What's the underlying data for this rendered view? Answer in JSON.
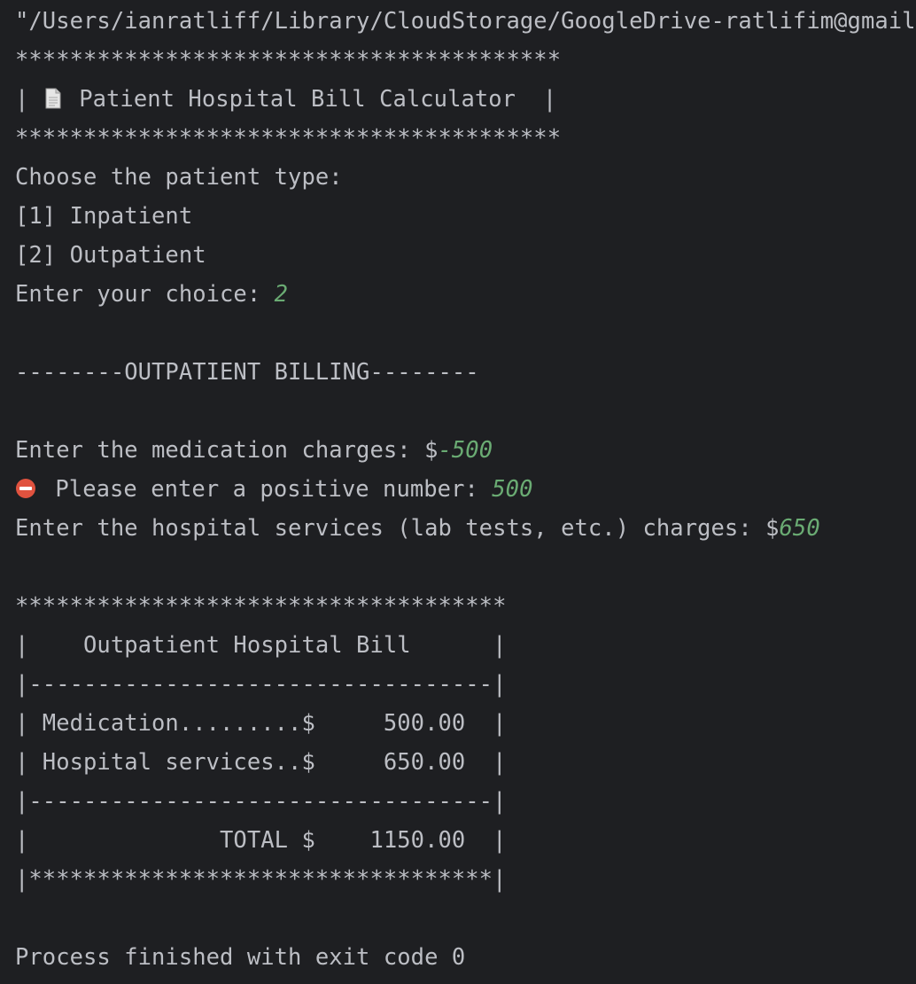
{
  "console": {
    "command_path": "\"/Users/ianratliff/Library/CloudStorage/GoogleDrive-ratlifim@gmail",
    "banner_border": "****************************************",
    "banner_title_prefix": "| ",
    "banner_icon": "page-icon",
    "banner_title": " Patient Hospital Bill Calculator  |",
    "patient_type_prompt": "Choose the patient type:",
    "option_1": "[1] Inpatient",
    "option_2": "[2] Outpatient",
    "choice_prompt": "Enter your choice: ",
    "choice_value": "2",
    "section_header": "--------OUTPATIENT BILLING--------",
    "medication_prompt": "Enter the medication charges: $",
    "medication_value_invalid": "-500",
    "error_icon": "no-entry-icon",
    "error_prompt": " Please enter a positive number: ",
    "medication_value": "500",
    "services_prompt": "Enter the hospital services (lab tests, etc.) charges: $",
    "services_value": "650",
    "bill": {
      "top_border": "************************************",
      "title_row": "|    Outpatient Hospital Bill      |",
      "divider": "|----------------------------------|",
      "medication_row": "| Medication.........$     500.00  |",
      "services_row": "| Hospital services..$     650.00  |",
      "total_row": "|              TOTAL $    1150.00  |",
      "bottom_border": "|**********************************|"
    },
    "exit_message": "Process finished with exit code 0"
  },
  "colors": {
    "background": "#1e1f22",
    "text": "#bcbec4",
    "user_input": "#6aab73",
    "error_icon": "#e0523f"
  }
}
